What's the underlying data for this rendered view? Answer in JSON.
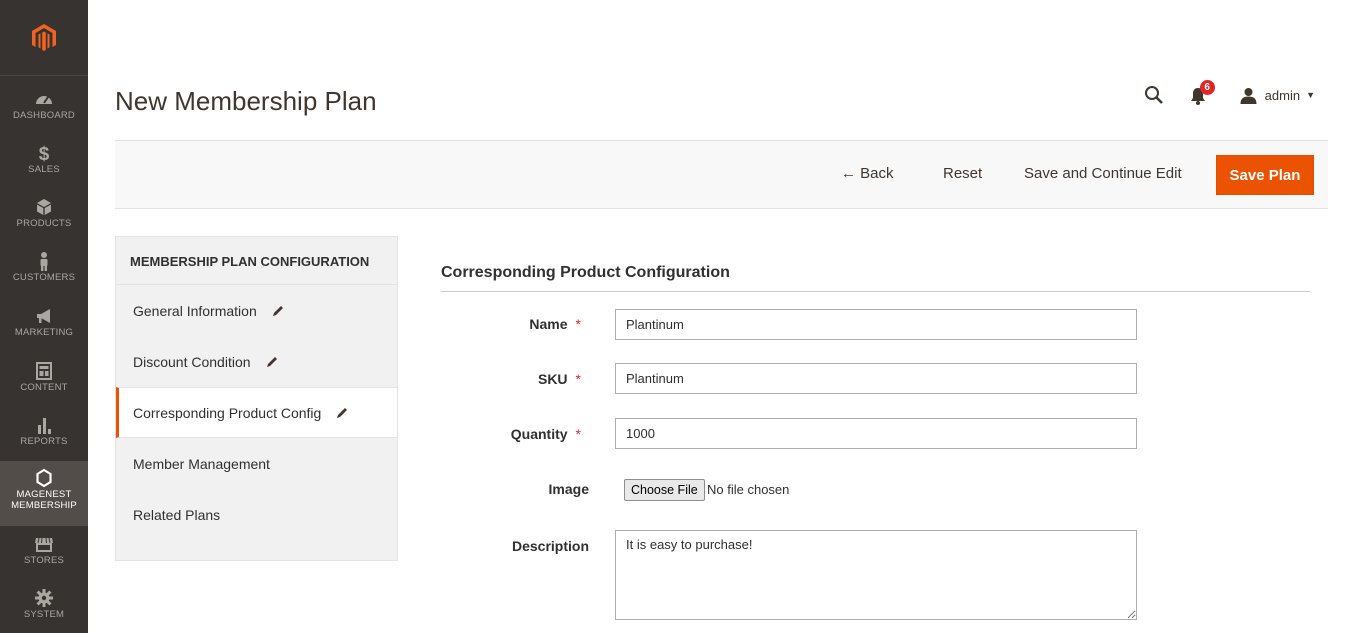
{
  "sidebar": {
    "items": [
      {
        "label": "DASHBOARD",
        "icon": "dashboard-icon"
      },
      {
        "label": "SALES",
        "icon": "dollar-icon"
      },
      {
        "label": "PRODUCTS",
        "icon": "cube-icon"
      },
      {
        "label": "CUSTOMERS",
        "icon": "person-icon"
      },
      {
        "label": "MARKETING",
        "icon": "megaphone-icon"
      },
      {
        "label": "CONTENT",
        "icon": "layout-icon"
      },
      {
        "label": "REPORTS",
        "icon": "bar-chart-icon"
      },
      {
        "label": "MAGENEST MEMBERSHIP",
        "icon": "hexagon-icon"
      },
      {
        "label": "STORES",
        "icon": "store-icon"
      },
      {
        "label": "SYSTEM",
        "icon": "gear-icon"
      }
    ],
    "active": "MAGENEST MEMBERSHIP"
  },
  "header": {
    "title": "New Membership Plan",
    "notifications": "6",
    "user": "admin"
  },
  "toolbar": {
    "back": "← Back",
    "reset": "Reset",
    "save_continue": "Save and Continue Edit",
    "save": "Save Plan"
  },
  "config_nav": {
    "heading": "MEMBERSHIP PLAN CONFIGURATION",
    "items": [
      {
        "label": "General Information"
      },
      {
        "label": "Discount Condition"
      },
      {
        "label": "Corresponding Product Config"
      },
      {
        "label": "Member Management"
      },
      {
        "label": "Related Plans"
      }
    ]
  },
  "form": {
    "section_title": "Corresponding Product Configuration",
    "name_label": "Name",
    "name_value": "Plantinum",
    "sku_label": "SKU",
    "sku_value": "Plantinum",
    "quantity_label": "Quantity",
    "quantity_value": "1000",
    "image_label": "Image",
    "file_button": "Choose File",
    "file_status": "No file chosen",
    "description_label": "Description",
    "description_value": "It is easy to purchase!",
    "required_mark": "*"
  },
  "colors": {
    "accent": "#eb5202",
    "sidebar_bg": "#373330",
    "badge": "#e22626"
  }
}
